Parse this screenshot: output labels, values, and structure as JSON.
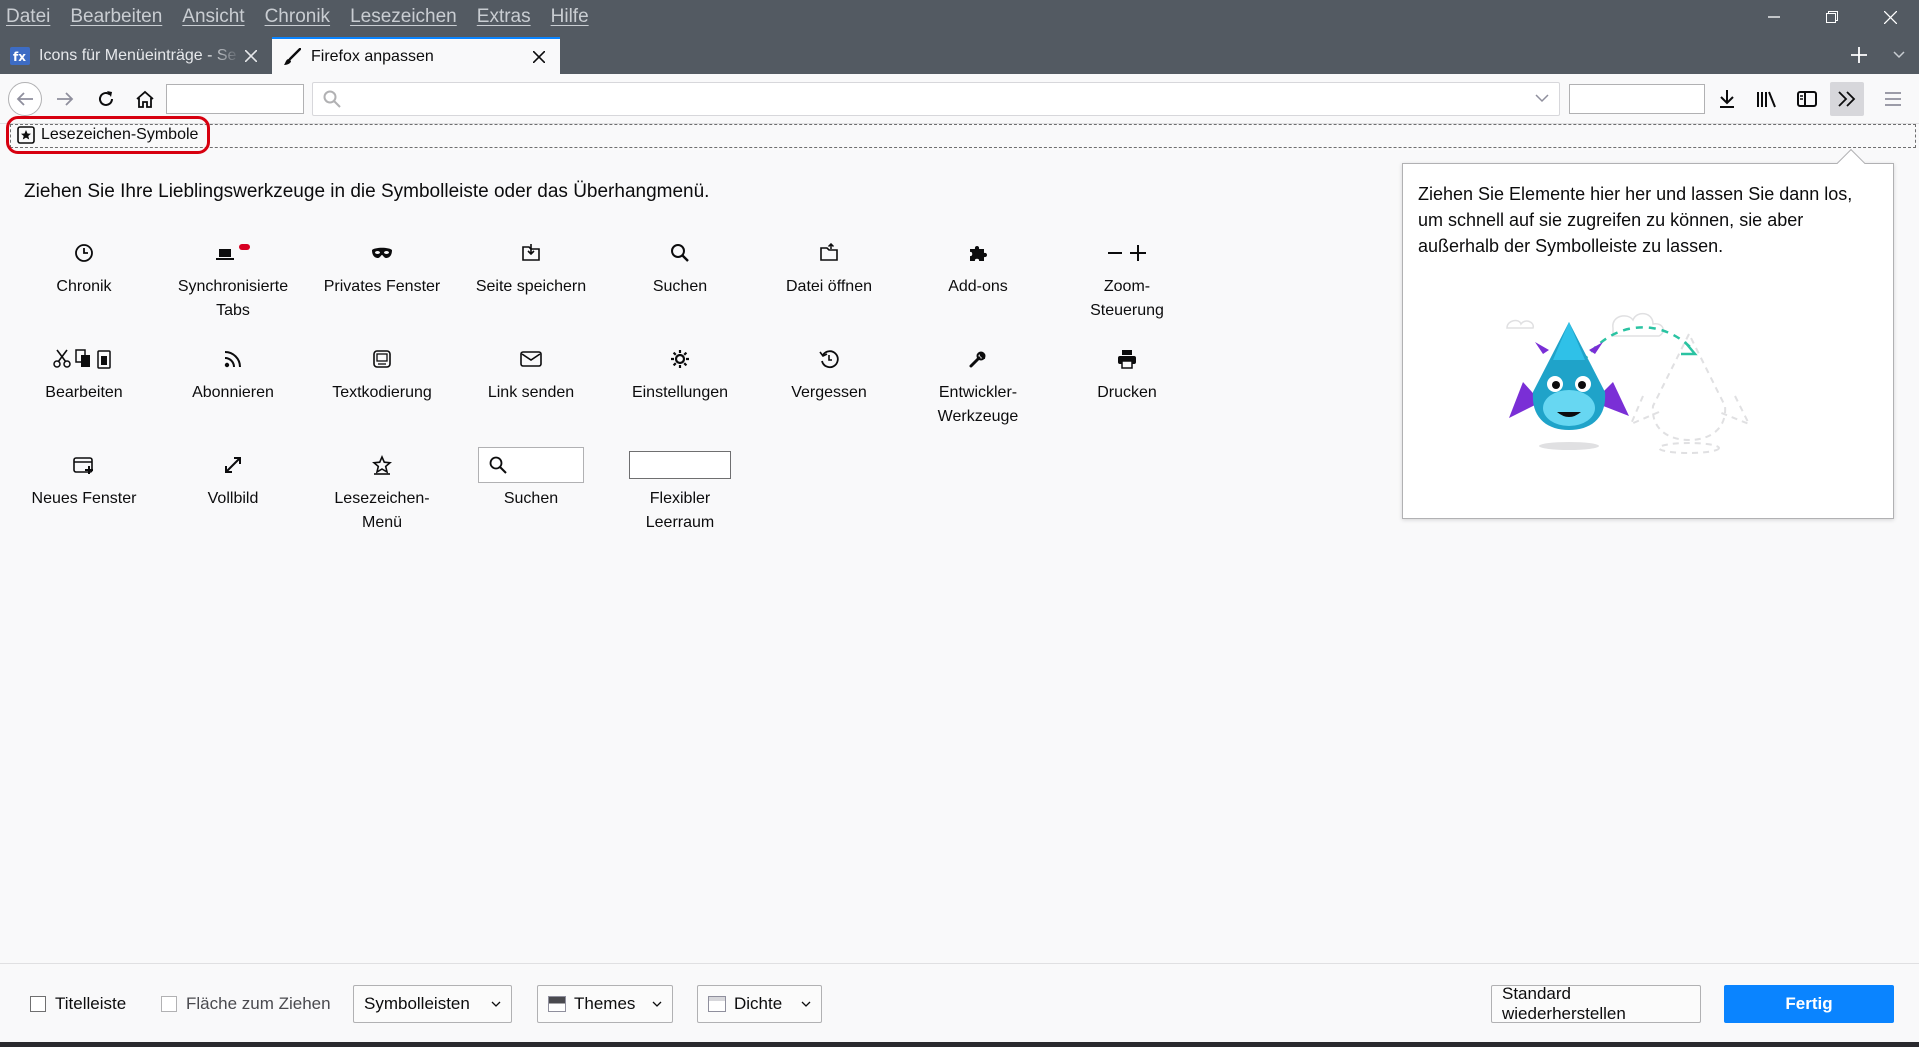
{
  "menubar": [
    "Datei",
    "Bearbeiten",
    "Ansicht",
    "Chronik",
    "Lesezeichen",
    "Extras",
    "Hilfe"
  ],
  "tabs": [
    {
      "title": "Icons für Menüeinträge - Se",
      "icon": "fx-icon"
    },
    {
      "title": "Firefox anpassen",
      "icon": "paintbrush-icon"
    }
  ],
  "bookmarks_item": "Lesezeichen-Symbole",
  "intro": "Ziehen Sie Ihre Lieblingswerkzeuge in die Symbolleiste oder das Überhangmenü.",
  "palette": [
    {
      "label": "Chronik",
      "icon": "clock-icon"
    },
    {
      "label": "Synchronisierte\nTabs",
      "icon": "synced-tabs-icon"
    },
    {
      "label": "Privates Fenster",
      "icon": "mask-icon"
    },
    {
      "label": "Seite speichern",
      "icon": "save-page-icon"
    },
    {
      "label": "Suchen",
      "icon": "search-icon"
    },
    {
      "label": "Datei öffnen",
      "icon": "open-file-icon"
    },
    {
      "label": "Add-ons",
      "icon": "puzzle-icon"
    },
    {
      "label": "Zoom-\nSteuerung",
      "icon": "zoom-icon"
    },
    {
      "label": "Bearbeiten",
      "icon": "edit-icon"
    },
    {
      "label": "Abonnieren",
      "icon": "feed-icon"
    },
    {
      "label": "Textkodierung",
      "icon": "encoding-icon"
    },
    {
      "label": "Link senden",
      "icon": "mail-icon"
    },
    {
      "label": "Einstellungen",
      "icon": "gear-icon"
    },
    {
      "label": "Vergessen",
      "icon": "forget-icon"
    },
    {
      "label": "Entwickler-\nWerkzeuge",
      "icon": "wrench-icon"
    },
    {
      "label": "Drucken",
      "icon": "printer-icon"
    },
    {
      "label": "Neues Fenster",
      "icon": "new-window-icon"
    },
    {
      "label": "Vollbild",
      "icon": "fullscreen-icon"
    },
    {
      "label": "Lesezeichen-\nMenü",
      "icon": "bookmark-star-icon"
    },
    {
      "label": "Suchen",
      "icon": "search-field"
    },
    {
      "label": "Flexibler\nLeerraum",
      "icon": "flexible-space"
    }
  ],
  "overflow_panel": {
    "text": "Ziehen Sie Elemente hier her und lassen Sie dann los, um schnell auf sie zugreifen zu können, sie aber außerhalb der Symbolleiste zu lassen."
  },
  "footer": {
    "titlebar_checkbox": "Titelleiste",
    "drag_space_checkbox": "Fläche zum Ziehen",
    "toolbars_button": "Symbolleisten",
    "themes_button": "Themes",
    "density_button": "Dichte",
    "restore_button": "Standard wiederherstellen",
    "done_button": "Fertig"
  },
  "colors": {
    "accent": "#0a84ff",
    "highlight_ring": "#d7000f",
    "titlebar": "#535a62"
  }
}
